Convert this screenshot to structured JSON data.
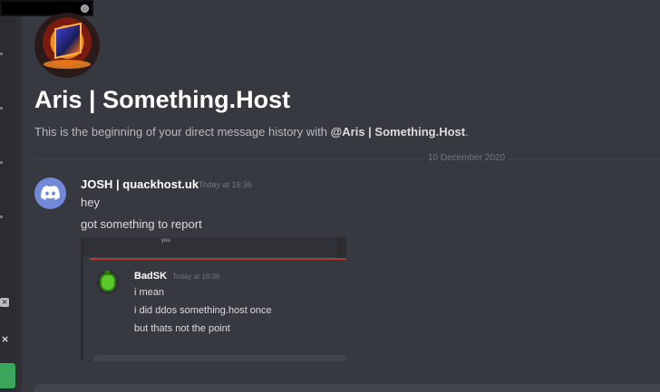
{
  "profile": {
    "name": "Aris | Something.Host",
    "intro_text": "This is the beginning of your direct message history with ",
    "intro_mention": "@Aris | Something.Host",
    "intro_end": "."
  },
  "divider": {
    "date": "10 December 2020"
  },
  "message": {
    "author": "JOSH | quackhost.uk",
    "timestamp": "Today at 16:36",
    "lines": [
      "hey",
      "got something to report"
    ]
  },
  "attachment": {
    "header_text": "you",
    "author": "BadSK",
    "timestamp": "Today at 16:36",
    "lines": [
      "i mean",
      "i did ddos something.host once",
      "but thats not the point"
    ]
  },
  "colors": {
    "background": "#36393f",
    "sidebar": "#2f3136",
    "blurple": "#7289da",
    "green": "#3ba55c"
  },
  "icons": [
    "discord-logo-icon",
    "close-icon",
    "server-avatar-icon"
  ]
}
